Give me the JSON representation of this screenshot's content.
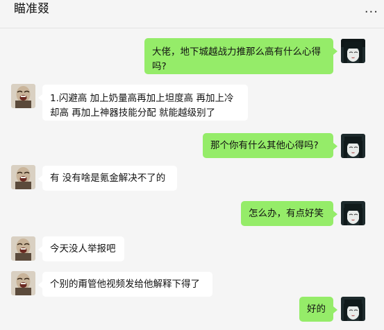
{
  "header": {
    "title": "瞄准叕",
    "more_label": "..."
  },
  "messages": [
    {
      "sender": "me",
      "text": "大佬，地下城越战力推那么高有什么心得吗?"
    },
    {
      "sender": "other",
      "text": "1.闪避高 加上奶量高再加上坦度高  再加上冷却高 再加上神器技能分配 就能越级别了"
    },
    {
      "sender": "me",
      "text": "那个你有什么其他心得吗?"
    },
    {
      "sender": "other",
      "text": "有 没有啥是氪金解决不了的"
    },
    {
      "sender": "me",
      "text": "怎么办，有点好笑"
    },
    {
      "sender": "other",
      "text": "今天没人举报吧"
    },
    {
      "sender": "other",
      "text": "个别的甭管他视频发给他解释下得了"
    },
    {
      "sender": "me",
      "text": "好的"
    }
  ],
  "colors": {
    "my_bubble": "#95ec69",
    "other_bubble": "#ffffff",
    "background": "#f5f5f5"
  }
}
